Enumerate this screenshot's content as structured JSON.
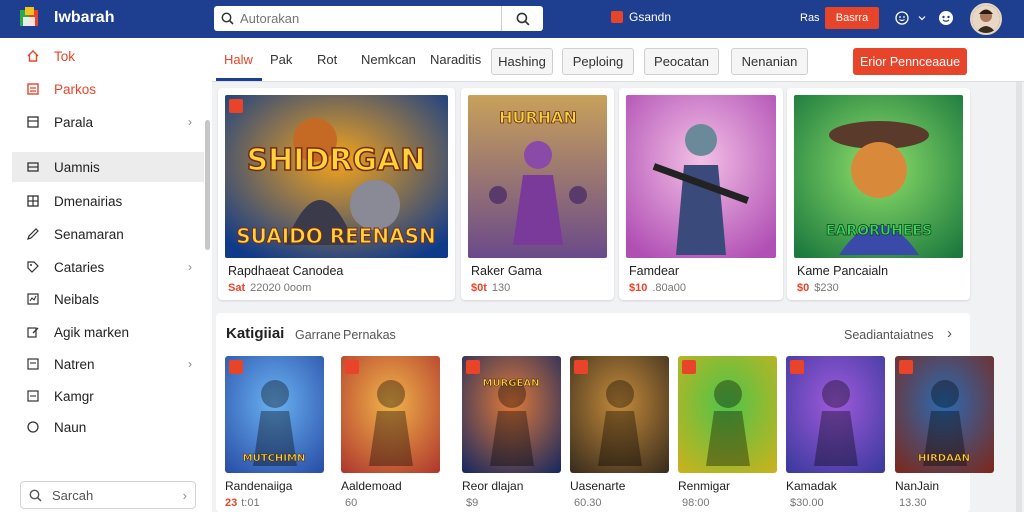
{
  "brand": {
    "name": "Iwbarah"
  },
  "search": {
    "placeholder": "Autorakan"
  },
  "topbar": {
    "store_label": "Gsandn",
    "user_label": "Ras",
    "button_label": "Basrra"
  },
  "sidebar": {
    "items": [
      {
        "label": "Tok",
        "icon": "home-icon"
      },
      {
        "label": "Parkos",
        "icon": "bookmark-icon"
      },
      {
        "label": "Parala",
        "icon": "page-icon"
      },
      {
        "label": "Uamnis",
        "icon": "window-icon"
      },
      {
        "label": "Dmenairias",
        "icon": "grid-icon"
      },
      {
        "label": "Senamaran",
        "icon": "pencil-icon"
      },
      {
        "label": "Cataries",
        "icon": "tag-icon"
      },
      {
        "label": "Neibals",
        "icon": "chart-icon"
      },
      {
        "label": "Agik marken",
        "icon": "edit-icon"
      },
      {
        "label": "Natren",
        "icon": "card-icon"
      },
      {
        "label": "Kamgr",
        "icon": "box-icon"
      },
      {
        "label": "Naun",
        "icon": "circle-icon"
      }
    ],
    "search_label": "Sarcah"
  },
  "tabs": [
    "Halw",
    "Pak",
    "Rot",
    "Nemkcan",
    "Naraditis"
  ],
  "pills": [
    "Hashing",
    "Peploing",
    "Peocatan",
    "Nenanian"
  ],
  "cta_label": "Erior Pennceaaue",
  "featured": [
    {
      "title": "Rapdhaeat Canodea",
      "price_red": "Sat",
      "price": "22020 0oom",
      "art_text_top": "SHIDRGAN",
      "art_text_bottom": "SUAIDO REENASN",
      "colors": [
        "#0f3a8a",
        "#f4a41c"
      ]
    },
    {
      "title": "Raker Gama",
      "price_red": "$0t",
      "price": "130",
      "art_text_top": "HURHAN",
      "art_text_bottom": "",
      "colors": [
        "#6a4a8a",
        "#c8a15a"
      ]
    },
    {
      "title": "Famdear",
      "price_red": "$10",
      "price": ".80a00",
      "art_text_top": "",
      "art_text_bottom": "",
      "colors": [
        "#b04fb4",
        "#f3c0e6"
      ]
    },
    {
      "title": "Kame Pancaialn",
      "price_red": "$0",
      "price": "$230",
      "art_text_top": "",
      "art_text_bottom": "EARORUHEES",
      "colors": [
        "#1c7a3e",
        "#8fe06a"
      ]
    }
  ],
  "section": {
    "title": "Katigiiai",
    "tabs": [
      "Garrane",
      "Pernakas"
    ],
    "more_label": "Seadiantaiatnes"
  },
  "games": [
    {
      "title": "Randenaiiga",
      "price_red": "23",
      "price": "t:01",
      "art_text": "MUTCHIMN",
      "colors": [
        "#2a4fa8",
        "#6ab2f2"
      ]
    },
    {
      "title": "Aaldemoad",
      "price_red": "",
      "price": "60",
      "art_text": "",
      "colors": [
        "#b03a2e",
        "#f2b44a"
      ]
    },
    {
      "title": "Reor dlajan",
      "price_red": "",
      "price": "$9",
      "art_text": "MURGEAN",
      "colors": [
        "#1c2a5e",
        "#e07a3a"
      ]
    },
    {
      "title": "Uasenarte",
      "price_red": "",
      "price": "60.30",
      "art_text": "",
      "colors": [
        "#3b2e1e",
        "#c48a3a"
      ]
    },
    {
      "title": "Renmigar",
      "price_red": "",
      "price": "98:00",
      "art_text": "",
      "colors": [
        "#c8b21e",
        "#4fc44a"
      ]
    },
    {
      "title": "Kamadak",
      "price_red": "",
      "price": "$30.00",
      "art_text": "",
      "colors": [
        "#3c3a9e",
        "#a05adc"
      ]
    },
    {
      "title": "NanJain",
      "price_red": "",
      "price": "13.30",
      "art_text": "HIRDAAN",
      "colors": [
        "#7a2a1e",
        "#2a6ab2"
      ]
    }
  ]
}
